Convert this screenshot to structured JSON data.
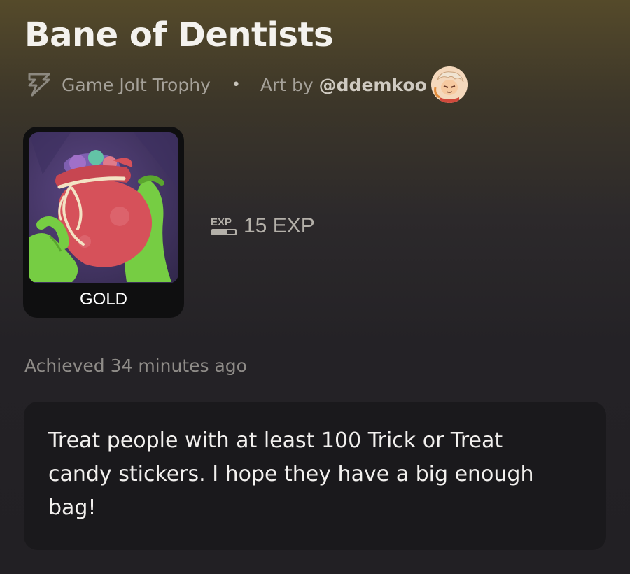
{
  "trophy": {
    "title": "Bane of Dentists",
    "type_label": "Game Jolt Trophy",
    "separator": "•",
    "art_by_label": "Art by",
    "artist_handle": "@ddemkoo",
    "tier": "GOLD",
    "exp_value": "15 EXP",
    "exp_icon_text": "EXP",
    "achieved": "Achieved 34 minutes ago",
    "description": "Treat people with at least 100 Trick or Treat candy stickers. I hope they have a big enough bag!"
  },
  "icons": {
    "trophy_type": "game-jolt-bolt-icon",
    "exp": "exp-badge-icon",
    "avatar": "artist-avatar"
  },
  "colors": {
    "tier_gold_frame": "#0f0f10",
    "art_background": "#4a3a6a",
    "bag": "#d9545a",
    "hands": "#7ed34a",
    "accent_text": "#cfcac1"
  }
}
